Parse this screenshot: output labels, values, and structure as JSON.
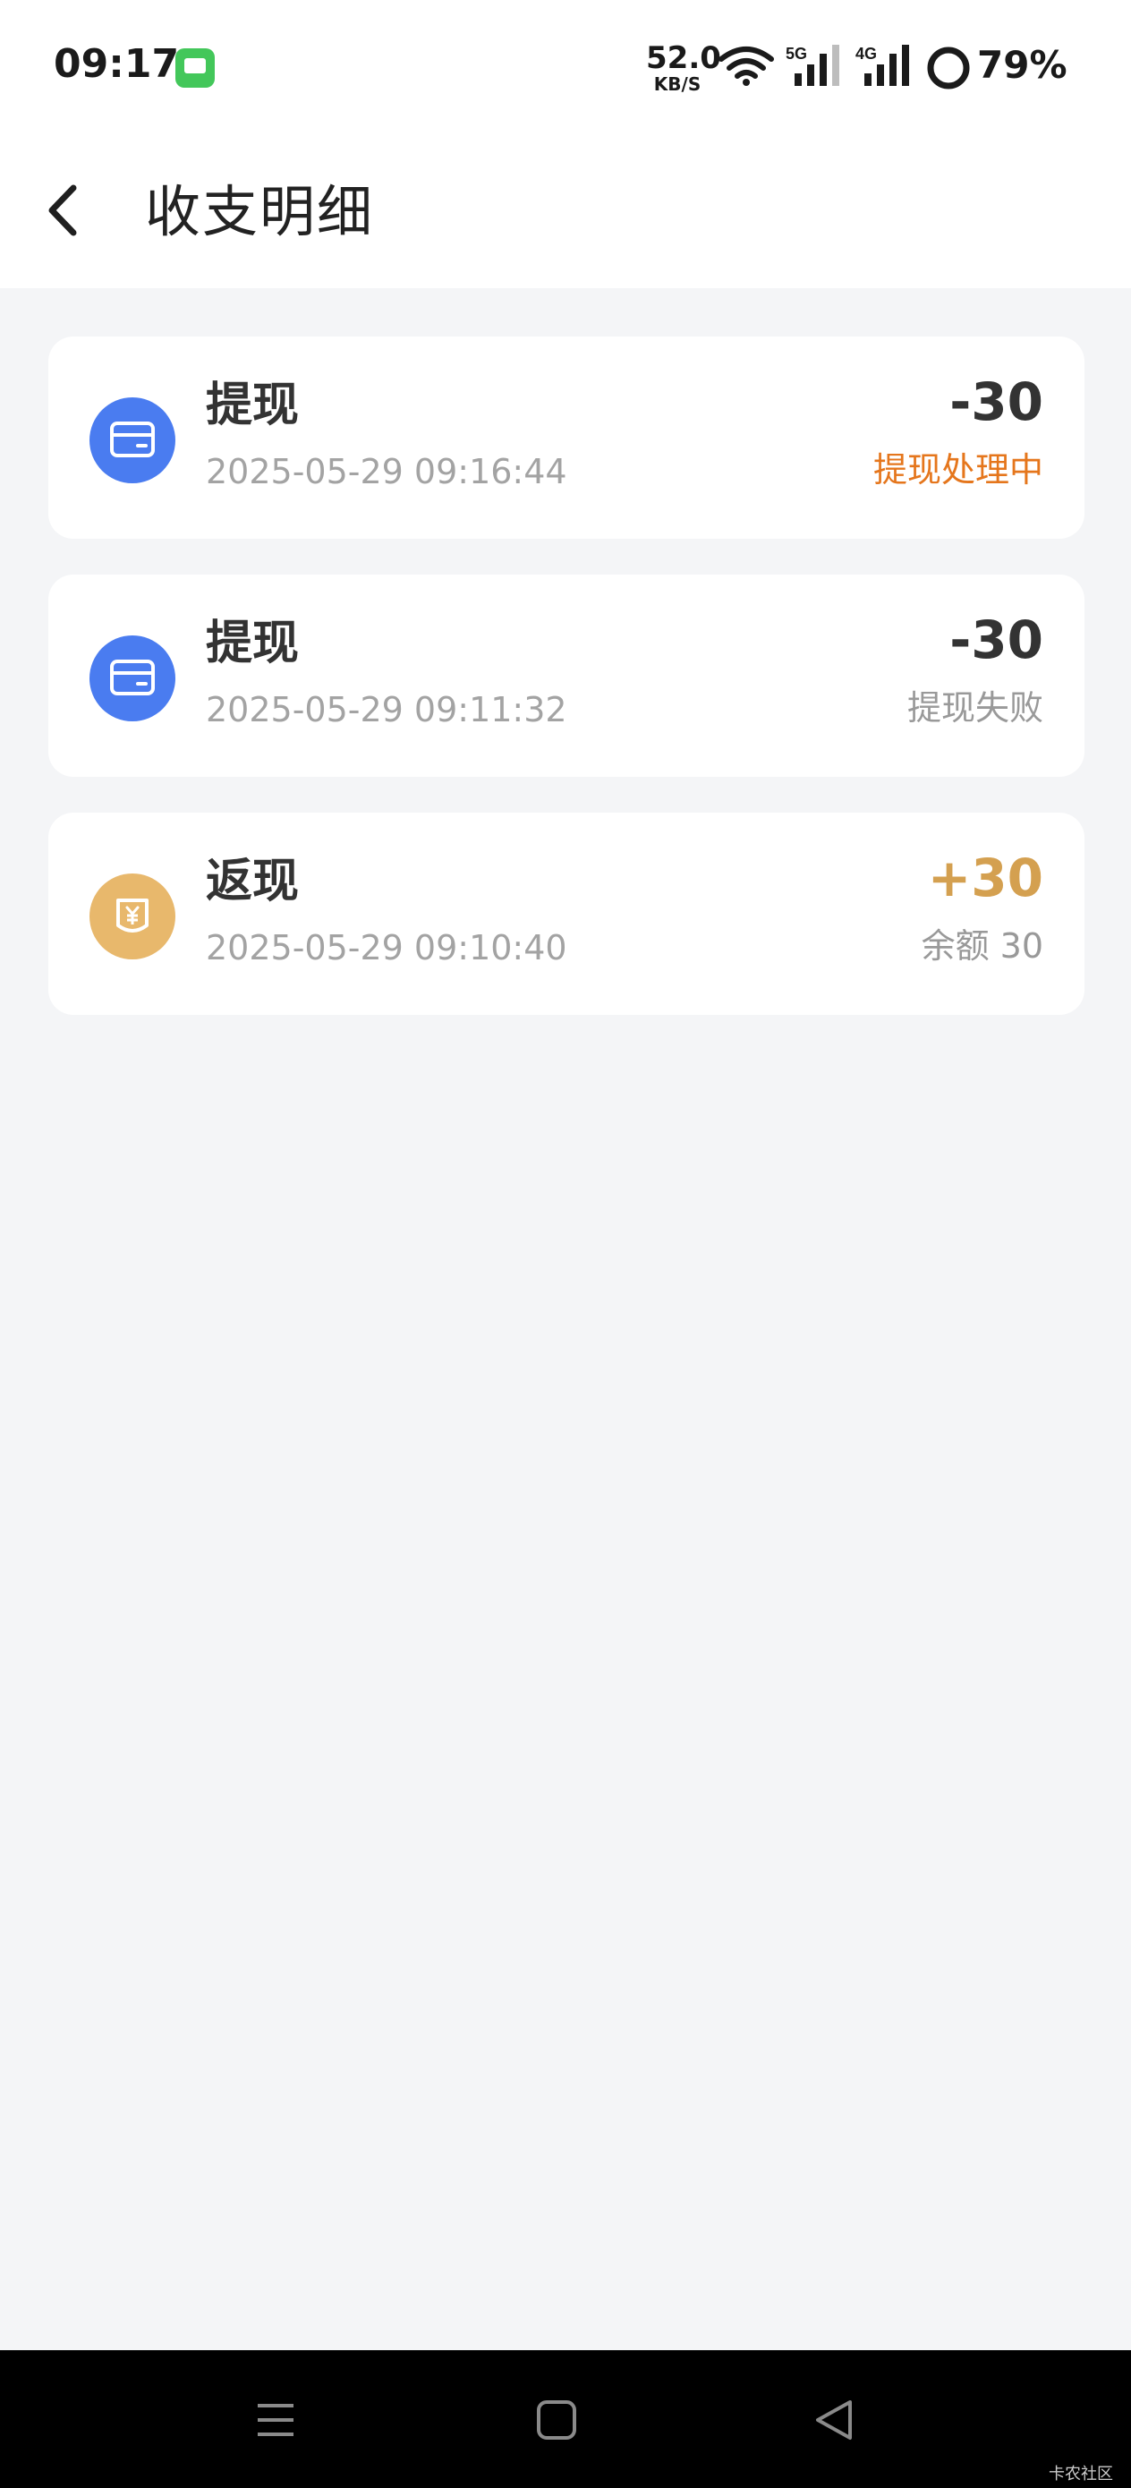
{
  "status_bar": {
    "time": "09:17",
    "net_speed_value": "52.0",
    "net_speed_unit": "KB/S",
    "signal_1": "5G",
    "signal_2": "4G",
    "battery": "79%"
  },
  "header": {
    "title": "收支明细",
    "back_icon": "chevron-left-icon"
  },
  "transactions": [
    {
      "title": "提现",
      "time": "2025-05-29 09:16:44",
      "amount": "-30",
      "status": "提现处理中",
      "icon": "card-icon",
      "icon_color": "#4a7cf0",
      "amount_color": "#333333",
      "status_color": "#e5761c"
    },
    {
      "title": "提现",
      "time": "2025-05-29 09:11:32",
      "amount": "-30",
      "status": "提现失败",
      "icon": "card-icon",
      "icon_color": "#4a7cf0",
      "amount_color": "#333333",
      "status_color": "#999999"
    },
    {
      "title": "返现",
      "time": "2025-05-29 09:10:40",
      "amount": "+30",
      "status": "余额 30",
      "icon": "yuan-bag-icon",
      "icon_color": "#e8b86c",
      "amount_color": "#d4a050",
      "status_color": "#999999"
    }
  ],
  "nav_bar": {
    "buttons": [
      "menu-icon",
      "home-icon",
      "back-triangle-icon"
    ]
  },
  "watermark": "卡农社区"
}
